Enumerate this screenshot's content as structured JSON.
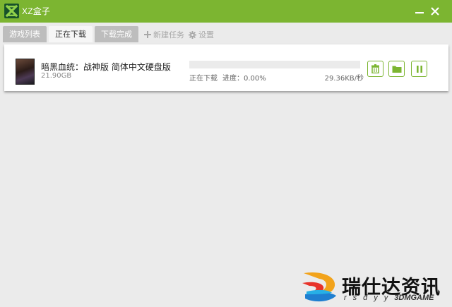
{
  "window": {
    "title": "XZ盒子",
    "accent_color": "#7cb531"
  },
  "tabs": [
    {
      "label": "游戏列表",
      "active": false
    },
    {
      "label": "正在下载",
      "active": true
    },
    {
      "label": "下载完成",
      "active": false
    }
  ],
  "toolbar": {
    "new_task_label": "新建任务",
    "new_task_icon": "plus-icon",
    "settings_label": "设置",
    "settings_icon": "gear-icon"
  },
  "downloads": [
    {
      "name": "暗黑血统：战神版 简体中文硬盘版",
      "size": "21.90GB",
      "status": "正在下载",
      "progress_text": "进度：0.00%",
      "progress_fraction": 0.0,
      "speed": "29.36KB/秒",
      "actions": [
        "trash-icon",
        "folder-icon",
        "pause-icon"
      ]
    }
  ],
  "watermark": {
    "title": "瑞仕达资讯",
    "sub_prefix": "rsdyy",
    "sub_brand": "3DMGAME"
  }
}
